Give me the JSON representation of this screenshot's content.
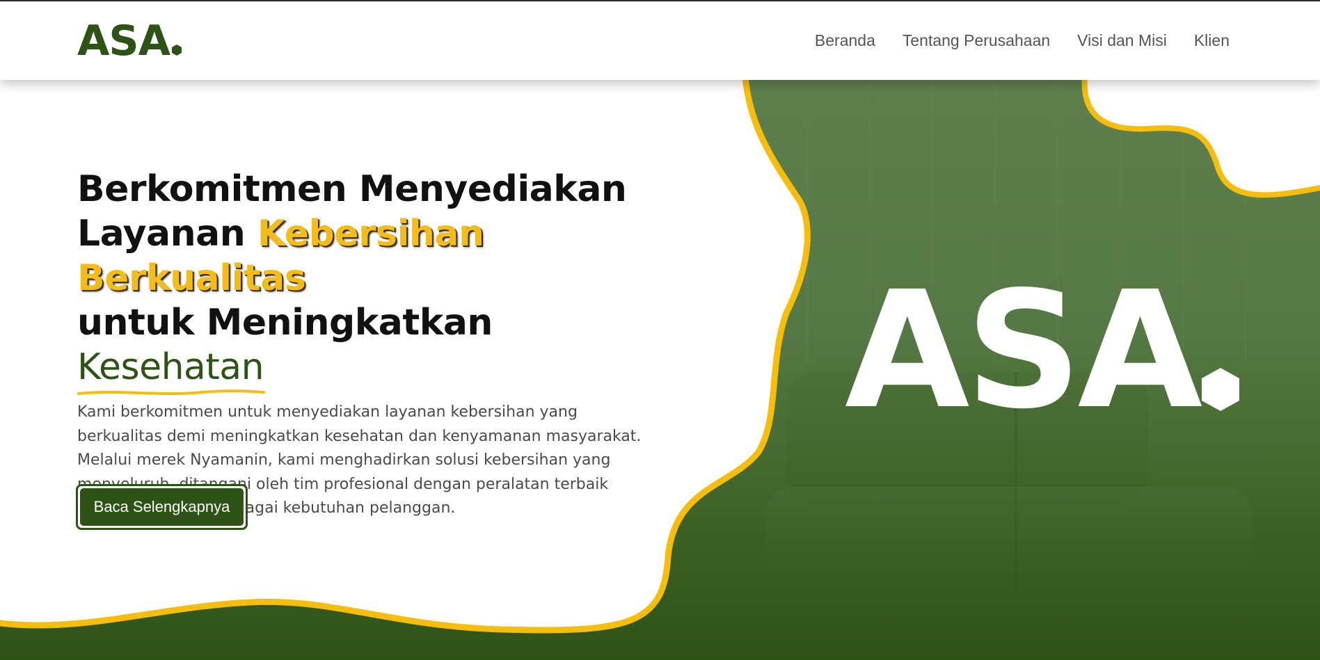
{
  "header": {
    "logo_text": "ASA",
    "nav": [
      {
        "label": "Beranda"
      },
      {
        "label": "Tentang Perusahaan"
      },
      {
        "label": "Visi dan Misi"
      },
      {
        "label": "Klien"
      }
    ]
  },
  "hero": {
    "headline": {
      "line1": "Berkomitmen Menyediakan",
      "line2_prefix": "Layanan ",
      "line2_highlight": "Kebersihan Berkualitas",
      "line3_prefix": "untuk Meningkatkan ",
      "line3_highlight": "Kesehatan"
    },
    "description": "Kami berkomitmen untuk menyediakan layanan kebersihan yang berkualitas demi meningkatkan kesehatan dan kenyamanan masyarakat. Melalui merek Nyamanin, kami menghadirkan solusi kebersihan yang menyeluruh, ditangani oleh tim profesional dengan peralatan terbaik untuk menjawab berbagai kebutuhan pelanggan.",
    "cta_label": "Baca Selengkapnya",
    "image_logo_text": "ASA"
  },
  "colors": {
    "brand_green": "#2e5317",
    "accent_yellow": "#f2bd18",
    "nav_text": "#555555"
  }
}
